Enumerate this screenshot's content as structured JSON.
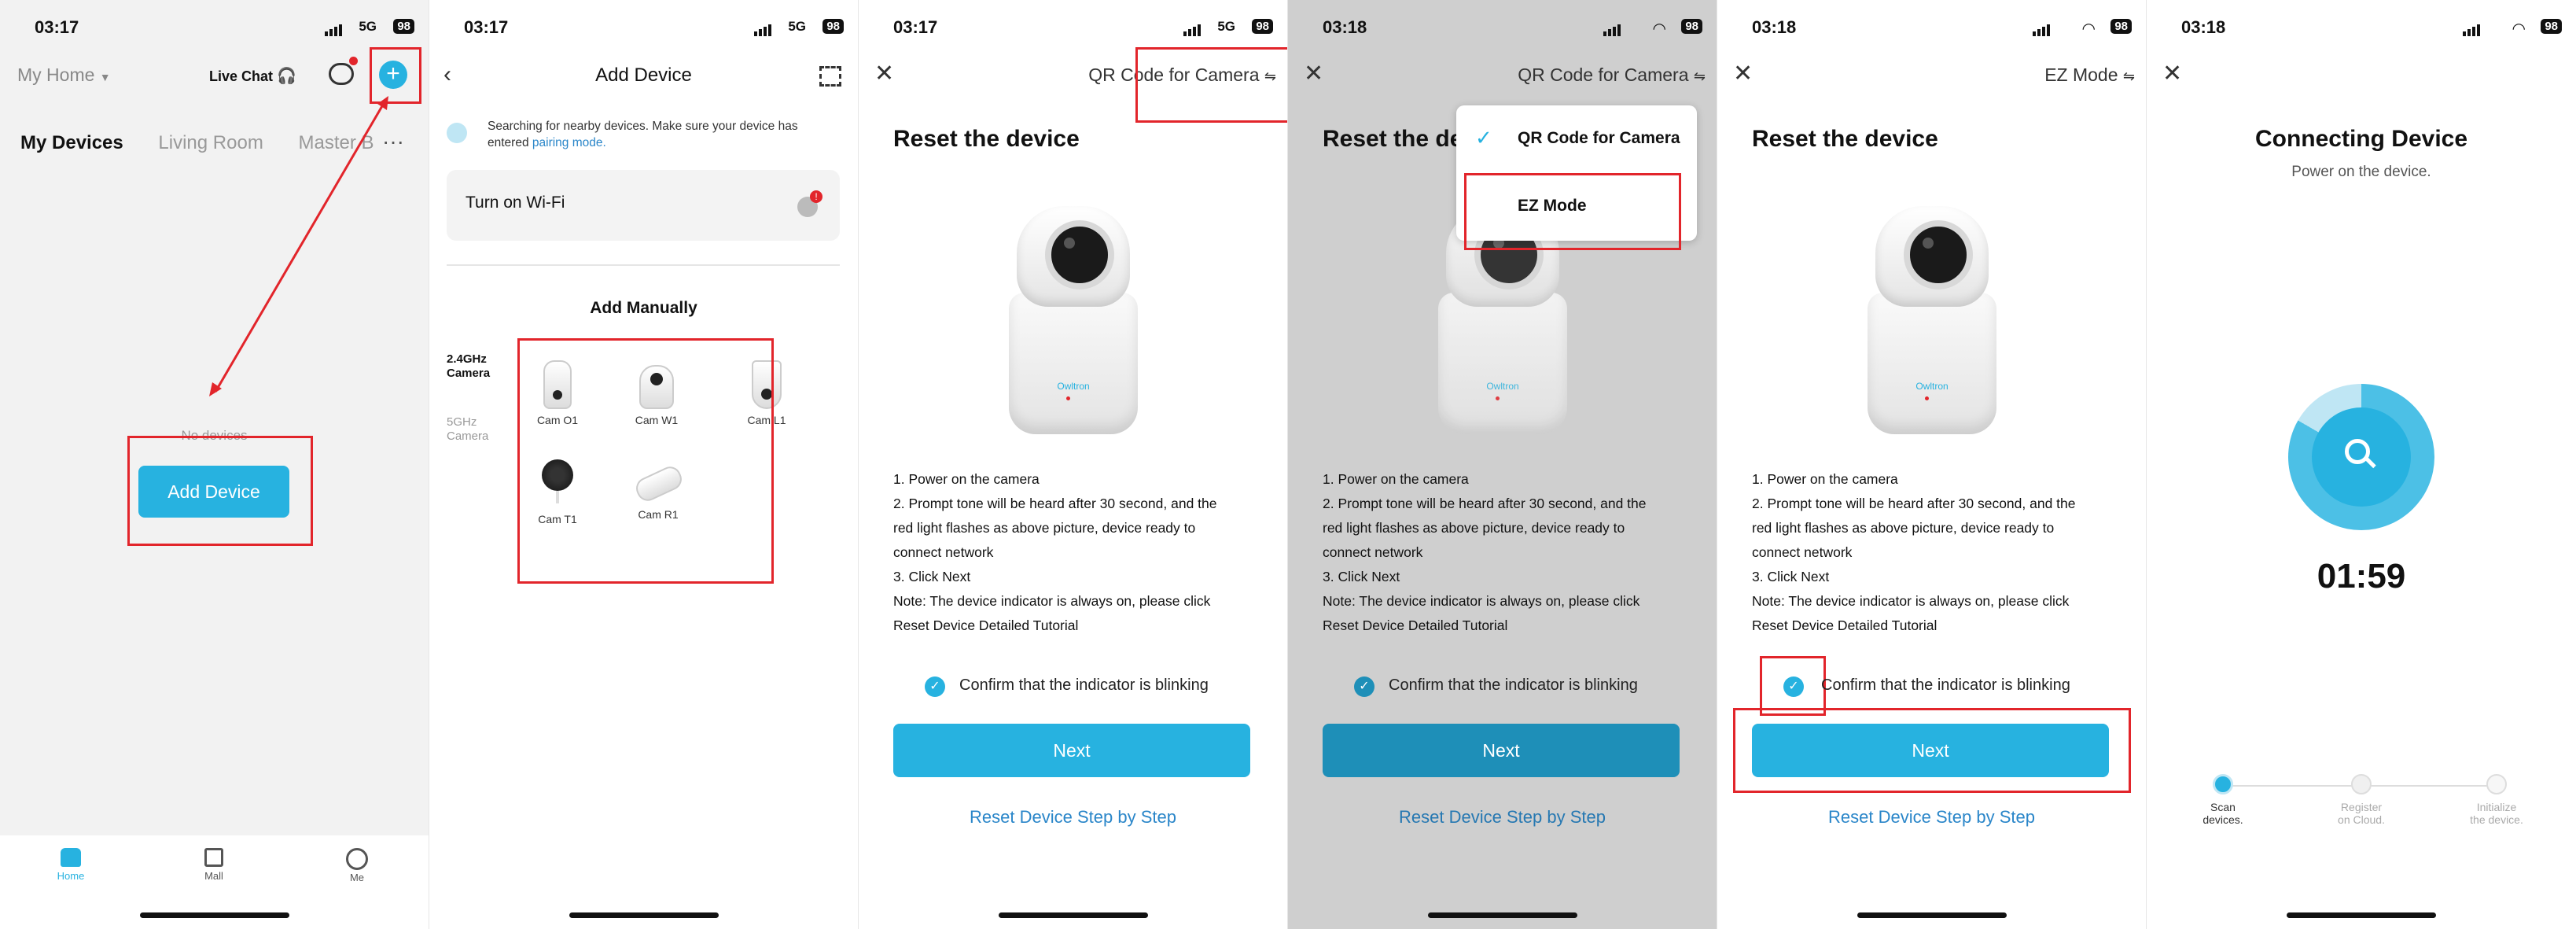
{
  "panel1": {
    "time": "03:17",
    "network": "5G",
    "battery": "98",
    "home_label": "My Home",
    "live_chat": "Live Chat",
    "tabs": [
      "My Devices",
      "Living Room",
      "Master B"
    ],
    "empty_text": "No devices",
    "add_device_button": "Add Device",
    "nav": [
      "Home",
      "Mall",
      "Me"
    ],
    "icons": [
      "chevron-down-icon",
      "headset-icon",
      "message-icon",
      "plus-icon",
      "more-icon",
      "home-icon",
      "bag-icon",
      "person-icon"
    ]
  },
  "panel2": {
    "time": "03:17",
    "network": "5G",
    "battery": "98",
    "title": "Add Device",
    "search_text": "Searching for nearby devices. Make sure your device has entered",
    "pairing_link": "pairing mode.",
    "wifi_row": "Turn on Wi-Fi",
    "wifi_badge": "!",
    "add_manually": "Add Manually",
    "categories": [
      "2.4GHz Camera",
      "5GHz Camera"
    ],
    "devices": [
      "Cam O1",
      "Cam W1",
      "Cam L1",
      "Cam T1",
      "Cam R1"
    ],
    "icons": [
      "back-icon",
      "scan-icon"
    ]
  },
  "panel3": {
    "time": "03:17",
    "network": "5G",
    "battery": "98",
    "mode_label": "QR Code for Camera",
    "title": "Reset the device",
    "brand": "Owltron",
    "steps": [
      "1. Power on the camera",
      "2. Prompt tone will be heard after 30 second, and the",
      "red light flashes as above picture, device ready to",
      "connect network",
      "3. Click Next",
      "Note: The device indicator is always on, please click",
      "Reset Device Detailed Tutorial"
    ],
    "confirm": "Confirm that the indicator is blinking",
    "next": "Next",
    "reset_link": "Reset Device Step by Step"
  },
  "panel4": {
    "time": "03:18",
    "battery": "98",
    "mode_label": "QR Code for Camera",
    "title": "Reset the de",
    "menu": [
      "QR Code for Camera",
      "EZ Mode"
    ],
    "brand": "Owltron",
    "steps": [
      "1. Power on the camera",
      "2. Prompt tone will be heard after 30 second, and the",
      "red light flashes as above picture, device ready to",
      "connect network",
      "3. Click Next",
      "Note: The device indicator is always on, please click",
      "Reset Device Detailed Tutorial"
    ],
    "confirm": "Confirm that the indicator is blinking",
    "next": "Next",
    "reset_link": "Reset Device Step by Step"
  },
  "panel5": {
    "time": "03:18",
    "battery": "98",
    "mode_label": "EZ Mode",
    "title": "Reset the device",
    "brand": "Owltron",
    "steps": [
      "1. Power on the camera",
      "2. Prompt tone will be heard after 30 second, and the",
      "red light flashes as above picture, device ready to",
      "connect network",
      "3. Click Next",
      "Note: The device indicator is always on, please click",
      "Reset Device Detailed Tutorial"
    ],
    "confirm": "Confirm that the indicator is blinking",
    "next": "Next",
    "reset_link": "Reset Device Step by Step"
  },
  "panel6": {
    "time": "03:18",
    "battery": "98",
    "title": "Connecting Device",
    "subtitle": "Power on the device.",
    "timer": "01:59",
    "progress_steps": [
      "Scan devices.",
      "Register on Cloud.",
      "Initialize the device."
    ],
    "active_step": 0
  },
  "colors": {
    "accent": "#27b2e0",
    "highlight": "#e2252b",
    "link": "#2a86c9"
  }
}
